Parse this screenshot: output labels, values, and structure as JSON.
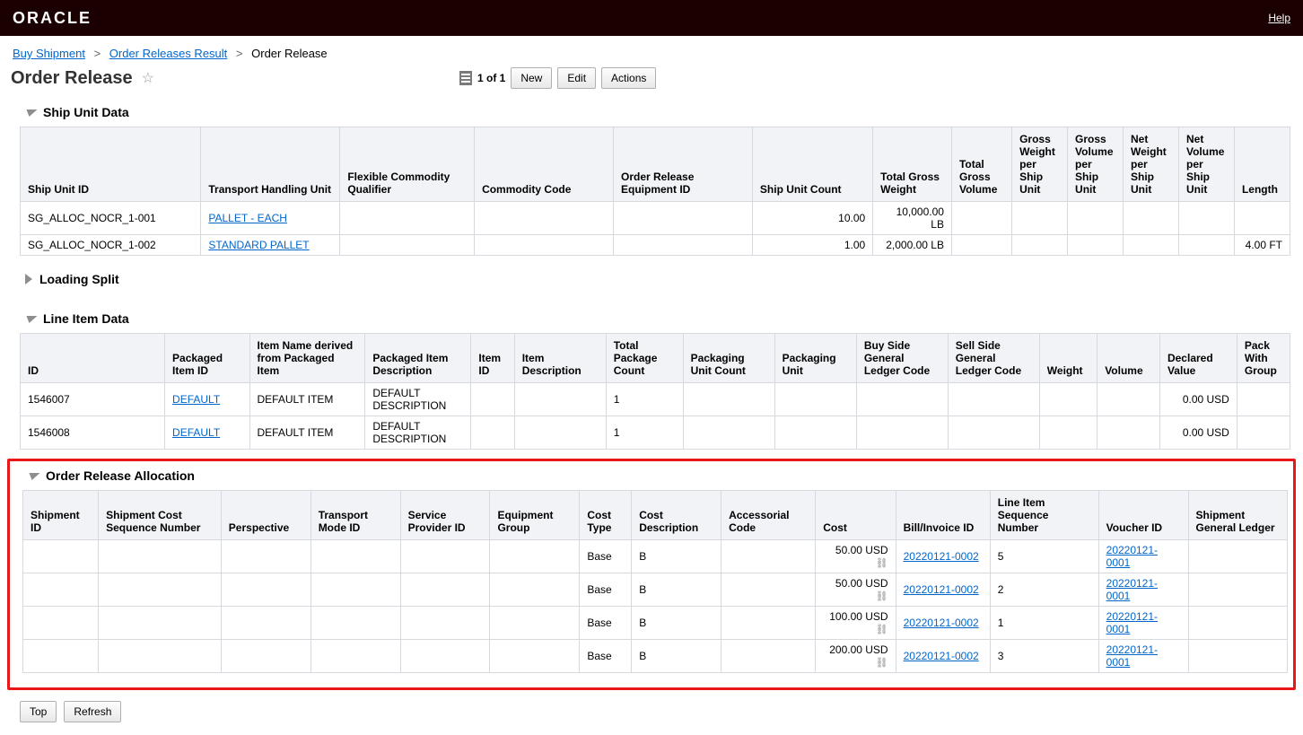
{
  "topbar": {
    "logo": "ORACLE",
    "help": "Help"
  },
  "breadcrumb": {
    "items": [
      "Buy Shipment",
      "Order Releases Result",
      "Order Release"
    ]
  },
  "header": {
    "title": "Order Release",
    "page_text": "1 of 1",
    "new": "New",
    "edit": "Edit",
    "actions": "Actions"
  },
  "sections": {
    "ship_unit": "Ship Unit Data",
    "loading_split": "Loading Split",
    "line_item": "Line Item Data",
    "order_alloc": "Order Release Allocation"
  },
  "ship_unit_table": {
    "headers": [
      "Ship Unit ID",
      "Transport Handling Unit",
      "Flexible Commodity Qualifier",
      "Commodity Code",
      "Order Release Equipment ID",
      "Ship Unit Count",
      "Total Gross Weight",
      "Total Gross Volume",
      "Gross Weight per Ship Unit",
      "Gross Volume per Ship Unit",
      "Net Weight per Ship Unit",
      "Net Volume per Ship Unit",
      "Length"
    ],
    "rows": [
      {
        "id": "SG_ALLOC_NOCR_1-001",
        "thu": "PALLET - EACH",
        "fcq": "",
        "cc": "",
        "ore": "",
        "count": "10.00",
        "tgw": "10,000.00 LB",
        "tgv": "",
        "gwpsu": "",
        "gvpsu": "",
        "nwpsu": "",
        "nvpsu": "",
        "length": ""
      },
      {
        "id": "SG_ALLOC_NOCR_1-002",
        "thu": "STANDARD PALLET",
        "fcq": "",
        "cc": "",
        "ore": "",
        "count": "1.00",
        "tgw": "2,000.00 LB",
        "tgv": "",
        "gwpsu": "",
        "gvpsu": "",
        "nwpsu": "",
        "nvpsu": "",
        "length": "4.00 FT"
      }
    ]
  },
  "line_item_table": {
    "headers": [
      "ID",
      "Packaged Item ID",
      "Item Name derived from Packaged Item",
      "Packaged Item Description",
      "Item ID",
      "Item Description",
      "Total Package Count",
      "Packaging Unit Count",
      "Packaging Unit",
      "Buy Side General Ledger Code",
      "Sell Side General Ledger Code",
      "Weight",
      "Volume",
      "Declared Value",
      "Pack With Group"
    ],
    "rows": [
      {
        "id": "1546007",
        "pitem": "DEFAULT",
        "iname": "DEFAULT ITEM",
        "pidesc": "DEFAULT DESCRIPTION",
        "itemid": "",
        "idesc": "",
        "tp": "1",
        "puc": "",
        "pu": "",
        "bsgl": "",
        "ssgl": "",
        "w": "",
        "v": "",
        "dv": "0.00 USD",
        "pwg": ""
      },
      {
        "id": "1546008",
        "pitem": "DEFAULT",
        "iname": "DEFAULT ITEM",
        "pidesc": "DEFAULT DESCRIPTION",
        "itemid": "",
        "idesc": "",
        "tp": "1",
        "puc": "",
        "pu": "",
        "bsgl": "",
        "ssgl": "",
        "w": "",
        "v": "",
        "dv": "0.00 USD",
        "pwg": ""
      }
    ]
  },
  "alloc_table": {
    "headers": [
      "Shipment ID",
      "Shipment Cost Sequence Number",
      "Perspective",
      "Transport Mode ID",
      "Service Provider ID",
      "Equipment Group",
      "Cost Type",
      "Cost Description",
      "Accessorial Code",
      "Cost",
      "Bill/Invoice ID",
      "Line Item Sequence Number",
      "Voucher ID",
      "Shipment General Ledger"
    ],
    "rows": [
      {
        "sid": "",
        "scsn": "",
        "persp": "",
        "tmid": "",
        "spid": "",
        "eg": "",
        "ctype": "Base",
        "cdesc": "B",
        "ac": "",
        "cost": "50.00 USD",
        "bill": "20220121-0002",
        "liseq": "5",
        "voucher": "20220121-0001",
        "sgl": ""
      },
      {
        "sid": "",
        "scsn": "",
        "persp": "",
        "tmid": "",
        "spid": "",
        "eg": "",
        "ctype": "Base",
        "cdesc": "B",
        "ac": "",
        "cost": "50.00 USD",
        "bill": "20220121-0002",
        "liseq": "2",
        "voucher": "20220121-0001",
        "sgl": ""
      },
      {
        "sid": "",
        "scsn": "",
        "persp": "",
        "tmid": "",
        "spid": "",
        "eg": "",
        "ctype": "Base",
        "cdesc": "B",
        "ac": "",
        "cost": "100.00 USD",
        "bill": "20220121-0002",
        "liseq": "1",
        "voucher": "20220121-0001",
        "sgl": ""
      },
      {
        "sid": "",
        "scsn": "",
        "persp": "",
        "tmid": "",
        "spid": "",
        "eg": "",
        "ctype": "Base",
        "cdesc": "B",
        "ac": "",
        "cost": "200.00 USD",
        "bill": "20220121-0002",
        "liseq": "3",
        "voucher": "20220121-0001",
        "sgl": ""
      }
    ]
  },
  "bottom": {
    "top": "Top",
    "refresh": "Refresh"
  }
}
